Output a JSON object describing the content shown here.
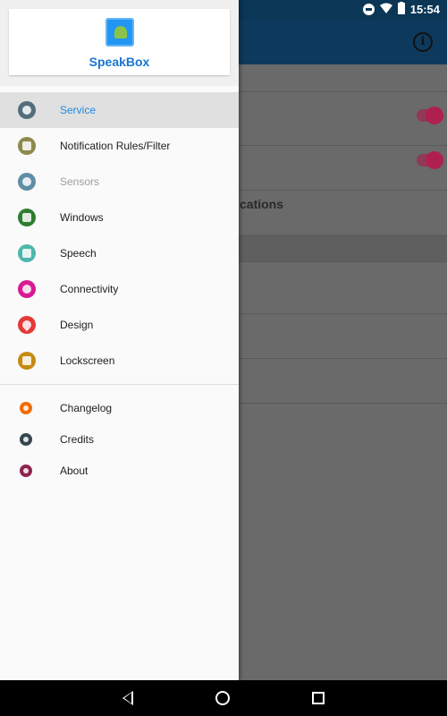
{
  "status_bar": {
    "time": "15:54",
    "left_icons": [
      "sim-icon",
      "speakbox-notification-icon",
      "flash-icon"
    ],
    "right_icons": [
      "do-not-disturb-icon",
      "wifi-icon",
      "battery-charging-icon"
    ]
  },
  "background_app": {
    "toolbar_icon": "info-icon",
    "info_glyph": "i",
    "partial_heading": "cations",
    "accent_color": "#b0204e"
  },
  "drawer": {
    "app_name": "SpeakBox",
    "logo": "speakbox-logo-icon",
    "items": [
      {
        "label": "Service",
        "icon": "globe-icon",
        "color": "#546e7a",
        "active": true
      },
      {
        "label": "Notification Rules/Filter",
        "icon": "list-icon",
        "color": "#8d8a4c"
      },
      {
        "label": "Sensors",
        "icon": "sync-icon",
        "color": "#5f8fa6",
        "disabled": true
      },
      {
        "label": "Windows",
        "icon": "folder-icon",
        "color": "#2e7d32"
      },
      {
        "label": "Speech",
        "icon": "megaphone-icon",
        "color": "#4db6ac"
      },
      {
        "label": "Connectivity",
        "icon": "rss-icon",
        "color": "#d81b93"
      },
      {
        "label": "Design",
        "icon": "droplet-icon",
        "color": "#e53935"
      },
      {
        "label": "Lockscreen",
        "icon": "lock-screen-icon",
        "color": "#c68a12"
      }
    ],
    "secondary_items": [
      {
        "label": "Changelog",
        "icon": "changelog-icon",
        "color": "#ef6c00"
      },
      {
        "label": "Credits",
        "icon": "paperclip-icon",
        "color": "#37474f"
      },
      {
        "label": "About",
        "icon": "power-icon",
        "color": "#8e244d"
      }
    ]
  },
  "nav_bar": {
    "buttons": [
      "back-icon",
      "home-icon",
      "recents-icon"
    ]
  }
}
